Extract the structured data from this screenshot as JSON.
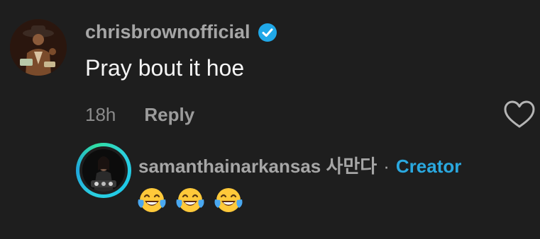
{
  "comment": {
    "username": "chrisbrownofficial",
    "verified_icon": "verified-badge-icon",
    "text": "Pray bout it hoe",
    "time": "18h",
    "reply_label": "Reply",
    "like_icon": "heart-outline-icon"
  },
  "reply": {
    "username": "samanthainarkansas 사만다",
    "separator": "·",
    "badge": "Creator",
    "emojis": [
      "face-with-tears-of-joy-icon",
      "face-with-tears-of-joy-icon",
      "face-with-tears-of-joy-icon"
    ]
  },
  "colors": {
    "background": "#1e1e1e",
    "verified": "#20a8e8",
    "creator": "#2aa8df",
    "ring": "#2bd0e0"
  }
}
